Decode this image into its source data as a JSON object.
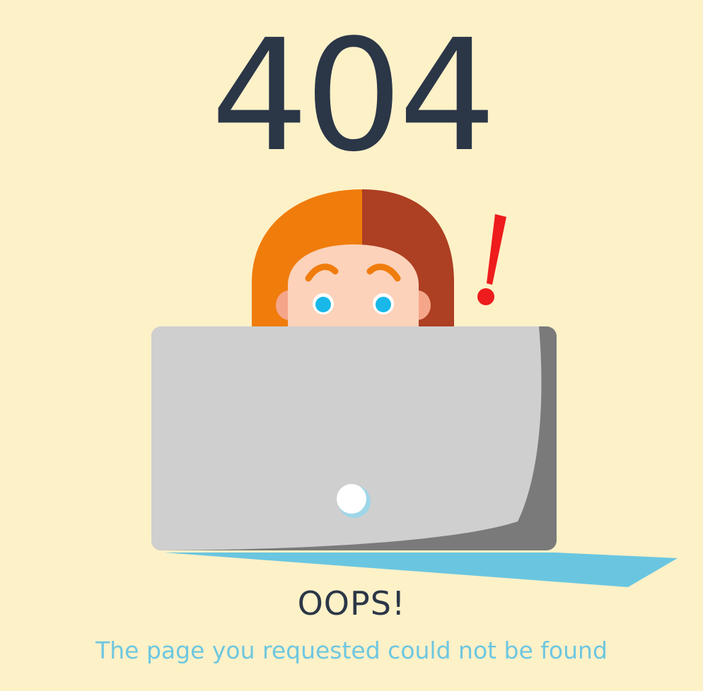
{
  "page": {
    "error_code": "404",
    "headline": "OOPS!",
    "message": "The page you requested could not be found"
  },
  "illustration": {
    "exclamation": "!",
    "colors": {
      "background": "#fdf1c8",
      "text_dark": "#2b3647",
      "text_accent": "#6ec7e0",
      "hair_left": "#f07c0c",
      "hair_right": "#ad3f22",
      "skin": "#fcd2ba",
      "eyes": "#19b8e8",
      "laptop_lid": "#cfcfcf",
      "laptop_side": "#7a7a7a",
      "shadow": "#6ac6e0",
      "exclamation": "#ee1c1c"
    }
  }
}
